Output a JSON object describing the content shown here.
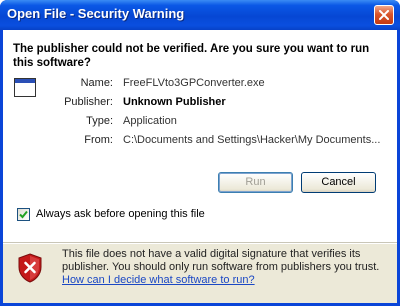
{
  "window": {
    "title": "Open File - Security Warning",
    "close_label": "close"
  },
  "headline": "The publisher could not be verified.  Are you sure you want to run this software?",
  "fields": [
    {
      "label": "Name:",
      "value": "FreeFLVto3GPConverter.exe"
    },
    {
      "label": "Publisher:",
      "value": "Unknown Publisher"
    },
    {
      "label": "Type:",
      "value": "Application"
    },
    {
      "label": "From:",
      "value": "C:\\Documents and Settings\\Hacker\\My Documents..."
    }
  ],
  "buttons": {
    "run": "Run",
    "cancel": "Cancel"
  },
  "checkbox": {
    "label": "Always ask before opening this file",
    "checked": true
  },
  "warning": {
    "text": "This file does not have a valid digital signature that verifies its publisher.  You should only run software from publishers you trust.",
    "link": "How can I decide what software to run?"
  },
  "colors": {
    "titlebar": "#0647d4",
    "body": "#ece9d8",
    "link": "#1b48c4",
    "shield": "#c41919"
  },
  "icons": {
    "close": "close-icon",
    "app": "application-icon",
    "shield": "security-shield-icon",
    "check": "checkmark-icon"
  }
}
